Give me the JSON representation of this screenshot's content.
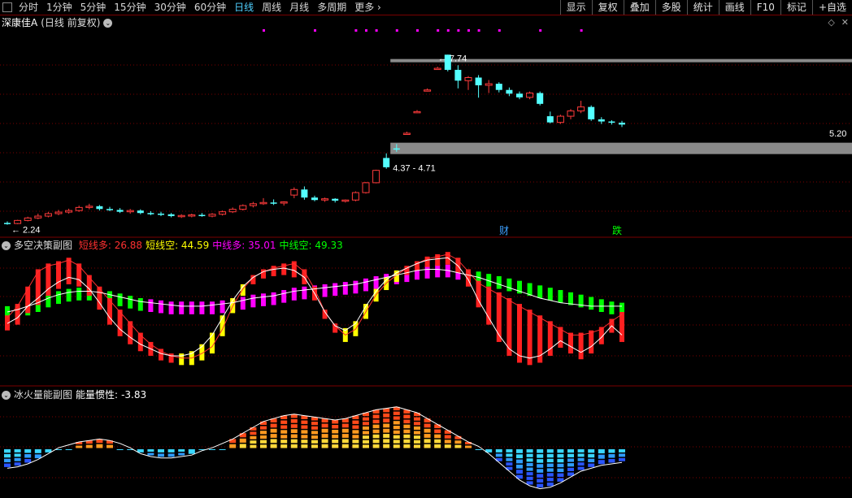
{
  "toolbar": {
    "periods": [
      "分时",
      "1分钟",
      "5分钟",
      "15分钟",
      "30分钟",
      "60分钟",
      "日线",
      "周线",
      "月线",
      "多周期",
      "更多"
    ],
    "active_period": "日线",
    "more_arrow": "›",
    "right_buttons": [
      "显示",
      "复权",
      "叠加",
      "多股",
      "统计",
      "画线",
      "F10",
      "标记",
      "+自选"
    ]
  },
  "main_panel": {
    "stock_name": "深康佳A",
    "mode": "(日线 前复权)",
    "high_label": "7.74",
    "low_label": "2.24",
    "last_label": "5.20",
    "zone_label": "4.37 - 4.71",
    "event_markers": [
      "财",
      "跌"
    ],
    "icons": [
      "diamond-icon",
      "close-icon"
    ]
  },
  "sub1": {
    "name": "多空决策副图",
    "items": [
      {
        "label": "短线多:",
        "value": "26.88",
        "color": "#ff3030"
      },
      {
        "label": "短线空:",
        "value": "44.59",
        "color": "#ffff00"
      },
      {
        "label": "中线多:",
        "value": "35.01",
        "color": "#ff00ff"
      },
      {
        "label": "中线空:",
        "value": "49.33",
        "color": "#00ff00"
      }
    ]
  },
  "sub2": {
    "name": "冰火量能副图",
    "label": "能量惯性:",
    "value": "-3.83"
  },
  "colors": {
    "up": "#ff3b3b",
    "down": "#54ffff",
    "grid": "#7a0000",
    "zone": "#8a8a8a",
    "magenta_dots": "#ff00ff"
  },
  "chart_data": {
    "type": "candlestick",
    "count": 61,
    "high_marker": 7.74,
    "low_marker": 2.24,
    "last_price": 5.2,
    "price_ylim": [
      2.1,
      8.3
    ],
    "ohlc": [
      [
        2.3,
        2.35,
        2.24,
        2.28
      ],
      [
        2.28,
        2.4,
        2.26,
        2.38
      ],
      [
        2.38,
        2.5,
        2.35,
        2.46
      ],
      [
        2.46,
        2.6,
        2.42,
        2.52
      ],
      [
        2.52,
        2.66,
        2.48,
        2.6
      ],
      [
        2.6,
        2.72,
        2.55,
        2.65
      ],
      [
        2.65,
        2.76,
        2.6,
        2.7
      ],
      [
        2.7,
        2.86,
        2.66,
        2.8
      ],
      [
        2.8,
        2.92,
        2.74,
        2.84
      ],
      [
        2.84,
        2.88,
        2.7,
        2.75
      ],
      [
        2.75,
        2.82,
        2.68,
        2.72
      ],
      [
        2.72,
        2.78,
        2.62,
        2.66
      ],
      [
        2.66,
        2.75,
        2.6,
        2.7
      ],
      [
        2.7,
        2.74,
        2.58,
        2.62
      ],
      [
        2.62,
        2.68,
        2.55,
        2.6
      ],
      [
        2.6,
        2.66,
        2.52,
        2.58
      ],
      [
        2.58,
        2.62,
        2.48,
        2.52
      ],
      [
        2.52,
        2.58,
        2.46,
        2.54
      ],
      [
        2.54,
        2.6,
        2.48,
        2.56
      ],
      [
        2.56,
        2.62,
        2.5,
        2.52
      ],
      [
        2.52,
        2.62,
        2.48,
        2.58
      ],
      [
        2.58,
        2.7,
        2.54,
        2.66
      ],
      [
        2.66,
        2.8,
        2.62,
        2.74
      ],
      [
        2.74,
        2.9,
        2.7,
        2.86
      ],
      [
        2.86,
        2.98,
        2.8,
        2.92
      ],
      [
        2.92,
        3.1,
        2.88,
        2.96
      ],
      [
        2.96,
        3.06,
        2.88,
        2.94
      ],
      [
        2.94,
        3.0,
        2.86,
        2.98
      ],
      [
        3.2,
        3.45,
        3.1,
        3.38
      ],
      [
        3.38,
        3.48,
        3.05,
        3.12
      ],
      [
        3.12,
        3.18,
        3.0,
        3.04
      ],
      [
        3.04,
        3.12,
        2.98,
        3.08
      ],
      [
        3.08,
        3.1,
        2.96,
        3.02
      ],
      [
        3.02,
        3.06,
        2.96,
        3.04
      ],
      [
        3.04,
        3.32,
        3.0,
        3.28
      ],
      [
        3.28,
        3.62,
        3.25,
        3.6
      ],
      [
        3.6,
        4.02,
        3.58,
        4.0
      ],
      [
        4.4,
        4.55,
        4.05,
        4.1
      ],
      [
        4.71,
        4.85,
        4.6,
        4.7
      ],
      [
        5.2,
        5.25,
        5.15,
        5.2
      ],
      [
        5.9,
        5.95,
        5.85,
        5.9
      ],
      [
        6.6,
        6.65,
        6.55,
        6.6
      ],
      [
        7.3,
        7.35,
        7.25,
        7.3
      ],
      [
        7.74,
        7.74,
        7.2,
        7.25
      ],
      [
        7.25,
        7.4,
        6.65,
        6.9
      ],
      [
        6.9,
        7.05,
        6.6,
        7.0
      ],
      [
        7.0,
        7.08,
        6.35,
        6.75
      ],
      [
        6.75,
        6.92,
        6.5,
        6.8
      ],
      [
        6.8,
        6.85,
        6.52,
        6.6
      ],
      [
        6.6,
        6.68,
        6.4,
        6.48
      ],
      [
        6.48,
        6.55,
        6.3,
        6.36
      ],
      [
        6.36,
        6.55,
        6.3,
        6.5
      ],
      [
        6.5,
        6.55,
        6.1,
        6.15
      ],
      [
        5.75,
        5.9,
        5.52,
        5.55
      ],
      [
        5.55,
        5.8,
        5.5,
        5.75
      ],
      [
        5.75,
        5.98,
        5.65,
        5.92
      ],
      [
        5.92,
        6.25,
        5.85,
        6.05
      ],
      [
        6.05,
        6.1,
        5.6,
        5.65
      ],
      [
        5.65,
        5.72,
        5.5,
        5.58
      ],
      [
        5.58,
        5.62,
        5.48,
        5.54
      ],
      [
        5.54,
        5.6,
        5.4,
        5.48
      ]
    ],
    "short_bull": [
      45,
      55,
      70,
      85,
      90,
      92,
      95,
      90,
      80,
      70,
      60,
      50,
      40,
      30,
      22,
      16,
      12,
      10,
      10,
      14,
      20,
      35,
      55,
      70,
      80,
      85,
      88,
      90,
      92,
      85,
      70,
      50,
      38,
      30,
      35,
      50,
      65,
      75,
      82,
      88,
      92,
      96,
      98,
      100,
      95,
      85,
      75,
      70,
      65,
      60,
      55,
      50,
      45,
      40,
      35,
      30,
      30,
      32,
      35,
      42,
      48
    ],
    "short_bear": [
      40,
      45,
      55,
      62,
      70,
      76,
      80,
      78,
      70,
      58,
      45,
      35,
      28,
      22,
      18,
      14,
      12,
      12,
      14,
      20,
      30,
      45,
      60,
      72,
      80,
      85,
      87,
      88,
      86,
      80,
      66,
      50,
      38,
      34,
      40,
      55,
      68,
      78,
      84,
      88,
      92,
      95,
      96,
      97,
      90,
      78,
      60,
      45,
      30,
      18,
      12,
      10,
      12,
      18,
      25,
      20,
      15,
      20,
      28,
      38,
      30
    ],
    "mid_bull": [
      50,
      52,
      55,
      58,
      62,
      65,
      67,
      68,
      68,
      67,
      65,
      63,
      61,
      59,
      58,
      57,
      56,
      55,
      55,
      55,
      56,
      57,
      58,
      60,
      62,
      63,
      64,
      66,
      68,
      69,
      70,
      71,
      72,
      73,
      74,
      76,
      78,
      80,
      82,
      84,
      86,
      87,
      87,
      86,
      84,
      82,
      80,
      77,
      74,
      71,
      68,
      65,
      62,
      60,
      58,
      57,
      56,
      55,
      55,
      55,
      55
    ],
    "mid_bear": [
      52,
      53,
      54,
      56,
      58,
      60,
      62,
      63,
      63,
      62,
      61,
      60,
      59,
      58,
      57,
      57,
      56,
      56,
      56,
      56,
      56,
      57,
      58,
      59,
      60,
      61,
      62,
      63,
      64,
      65,
      66,
      67,
      68,
      70,
      72,
      74,
      76,
      78,
      80,
      82,
      84,
      86,
      88,
      88,
      86,
      84,
      82,
      80,
      78,
      76,
      74,
      72,
      70,
      68,
      66,
      64,
      62,
      60,
      58,
      56,
      50
    ],
    "energy": [
      -18,
      -17,
      -15,
      -12,
      -8,
      -4,
      -2,
      0,
      1,
      2,
      1,
      -1,
      -4,
      -8,
      -10,
      -11,
      -11,
      -10,
      -9,
      -6,
      -4,
      -1,
      2,
      6,
      10,
      14,
      16,
      18,
      19,
      18,
      17,
      16,
      15,
      16,
      18,
      20,
      22,
      23,
      24,
      22,
      20,
      16,
      12,
      8,
      4,
      0,
      -3,
      -8,
      -14,
      -20,
      -26,
      -30,
      -32,
      -31,
      -28,
      -24,
      -20,
      -18,
      -16,
      -15,
      -14
    ]
  }
}
